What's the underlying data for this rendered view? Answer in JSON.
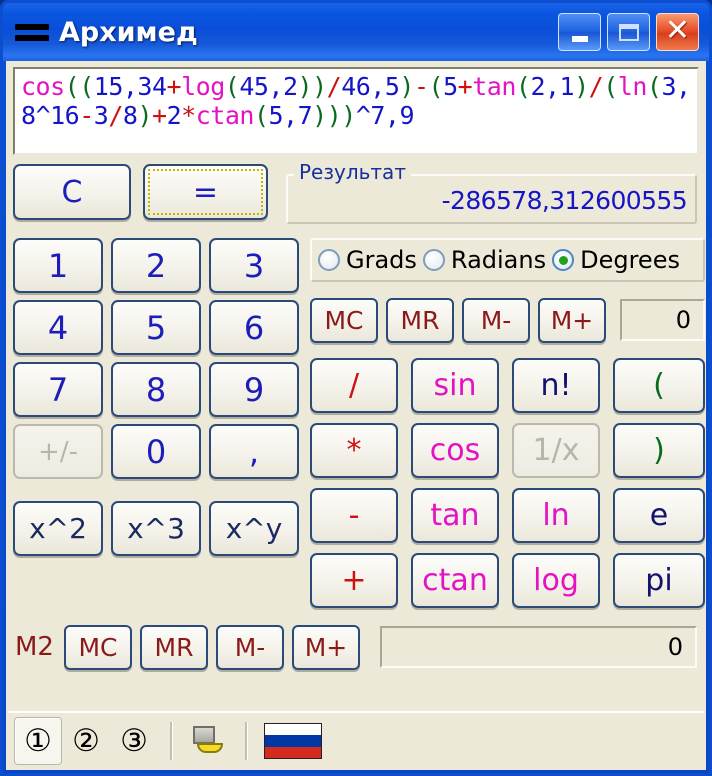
{
  "window": {
    "title": "Архимед",
    "app_icon": "equals-menu-icon",
    "minimize_label": "",
    "maximize_label": "",
    "close_label": "✕"
  },
  "expression": {
    "raw": "cos((15,34+log(45,2))/46,5)-(5+tan(2,1)/(ln(3,8^16-3/8)+2*ctan(5,7)))^7,9",
    "tokens": [
      {
        "t": "cos",
        "c": "fn"
      },
      {
        "t": "((",
        "c": "par"
      },
      {
        "t": "15,34",
        "c": "num"
      },
      {
        "t": "+",
        "c": "op"
      },
      {
        "t": "log",
        "c": "fn"
      },
      {
        "t": "(",
        "c": "par"
      },
      {
        "t": "45,2",
        "c": "num"
      },
      {
        "t": "))",
        "c": "par"
      },
      {
        "t": "/",
        "c": "op"
      },
      {
        "t": "46,5",
        "c": "num"
      },
      {
        "t": ")",
        "c": "par"
      },
      {
        "t": "-",
        "c": "op"
      },
      {
        "t": "(",
        "c": "par"
      },
      {
        "t": "5",
        "c": "num"
      },
      {
        "t": "+",
        "c": "op"
      },
      {
        "t": "tan",
        "c": "fn"
      },
      {
        "t": "(",
        "c": "par"
      },
      {
        "t": "2,1",
        "c": "num"
      },
      {
        "t": ")",
        "c": "par"
      },
      {
        "t": "/",
        "c": "op"
      },
      {
        "t": "(",
        "c": "par"
      },
      {
        "t": "ln",
        "c": "fn"
      },
      {
        "t": "(",
        "c": "par"
      },
      {
        "t": "3,8",
        "c": "num"
      },
      {
        "t": "^16",
        "c": "num"
      },
      {
        "t": "-",
        "c": "op"
      },
      {
        "t": "3",
        "c": "num"
      },
      {
        "t": "/",
        "c": "op"
      },
      {
        "t": "8",
        "c": "num"
      },
      {
        "t": ")",
        "c": "par"
      },
      {
        "t": "+",
        "c": "op"
      },
      {
        "t": "2",
        "c": "num"
      },
      {
        "t": "*",
        "c": "op"
      },
      {
        "t": "ctan",
        "c": "fn"
      },
      {
        "t": "(",
        "c": "par"
      },
      {
        "t": "5,7",
        "c": "num"
      },
      {
        "t": ")))",
        "c": "par"
      },
      {
        "t": "^7,9",
        "c": "num"
      }
    ]
  },
  "actions": {
    "clear_label": "C",
    "equals_label": "="
  },
  "result": {
    "group_label": "Результат",
    "value": "-286578,312600555"
  },
  "angle_mode": {
    "options": [
      {
        "label": "Grads",
        "selected": false
      },
      {
        "label": "Radians",
        "selected": false
      },
      {
        "label": "Degrees",
        "selected": true
      }
    ]
  },
  "numpad": {
    "keys": [
      {
        "label": "1",
        "disabled": false,
        "small": false
      },
      {
        "label": "2",
        "disabled": false,
        "small": false
      },
      {
        "label": "3",
        "disabled": false,
        "small": false
      },
      {
        "label": "4",
        "disabled": false,
        "small": false
      },
      {
        "label": "5",
        "disabled": false,
        "small": false
      },
      {
        "label": "6",
        "disabled": false,
        "small": false
      },
      {
        "label": "7",
        "disabled": false,
        "small": false
      },
      {
        "label": "8",
        "disabled": false,
        "small": false
      },
      {
        "label": "9",
        "disabled": false,
        "small": false
      },
      {
        "label": "+/-",
        "disabled": true,
        "small": true
      },
      {
        "label": "0",
        "disabled": false,
        "small": false
      },
      {
        "label": ",",
        "disabled": false,
        "small": false
      }
    ],
    "power_keys": [
      {
        "label": "x^2"
      },
      {
        "label": "x^3"
      },
      {
        "label": "x^y"
      }
    ]
  },
  "memory1": {
    "buttons": [
      "MC",
      "MR",
      "M-",
      "M+"
    ],
    "display": "0"
  },
  "memory2": {
    "label": "M2",
    "buttons": [
      "MC",
      "MR",
      "M-",
      "M+"
    ],
    "display": "0"
  },
  "function_pad": {
    "keys": [
      {
        "label": "/",
        "color": "op",
        "disabled": false
      },
      {
        "label": "sin",
        "color": "fn",
        "disabled": false
      },
      {
        "label": "n!",
        "color": "navy",
        "disabled": false
      },
      {
        "label": "(",
        "color": "par",
        "disabled": false
      },
      {
        "label": "*",
        "color": "op",
        "disabled": false
      },
      {
        "label": "cos",
        "color": "fn",
        "disabled": false
      },
      {
        "label": "1/x",
        "color": "navy",
        "disabled": true
      },
      {
        "label": ")",
        "color": "par",
        "disabled": false
      },
      {
        "label": "-",
        "color": "op",
        "disabled": false
      },
      {
        "label": "tan",
        "color": "fn",
        "disabled": false
      },
      {
        "label": "ln",
        "color": "fn",
        "disabled": false
      },
      {
        "label": "e",
        "color": "navy",
        "disabled": false
      },
      {
        "label": "+",
        "color": "op",
        "disabled": false
      },
      {
        "label": "ctan",
        "color": "fn",
        "disabled": false
      },
      {
        "label": "log",
        "color": "fn",
        "disabled": false
      },
      {
        "label": "pi",
        "color": "navy",
        "disabled": false
      }
    ]
  },
  "toolbar": {
    "memory_slots": [
      {
        "label": "①",
        "selected": true
      },
      {
        "label": "②",
        "selected": false
      },
      {
        "label": "③",
        "selected": false
      }
    ],
    "settings_icon": "system-settings-icon",
    "language_icon": "russian-flag-icon"
  },
  "colors": {
    "title_blue": "#0a4ed8",
    "face": "#ece9d8",
    "digit_blue": "#1d1dba",
    "operator_red": "#d01010",
    "function_magenta": "#e313c4",
    "paren_green": "#0a6b1f",
    "navy": "#13136e",
    "memory_dark_red": "#8b1a1a",
    "result_blue": "#1515c8",
    "radio_green": "#21a021"
  }
}
